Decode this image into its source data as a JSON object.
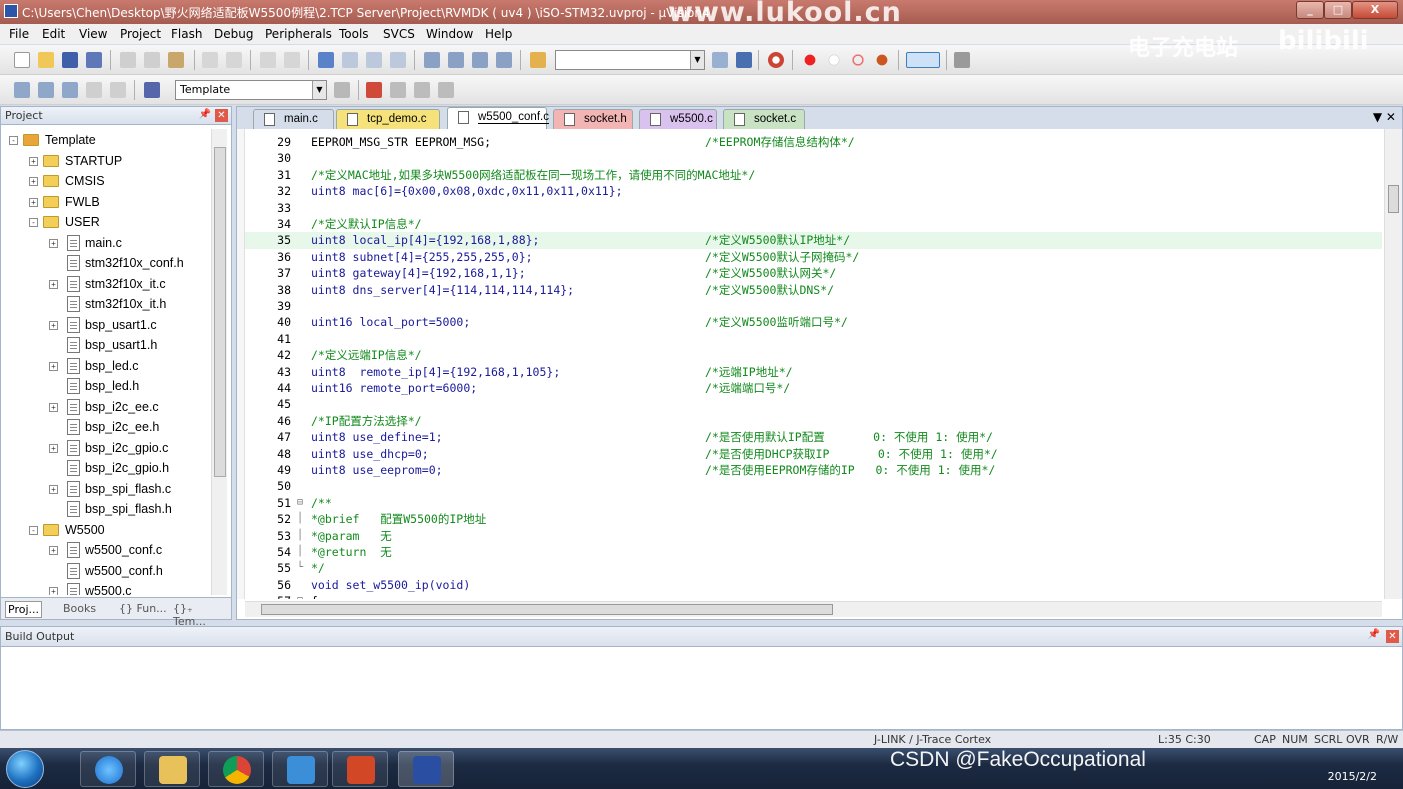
{
  "titlebar": {
    "title": "C:\\Users\\Chen\\Desktop\\野火网络适配板W5500例程\\2.TCP Server\\Project\\RVMDK ( uv4 ) \\iSO-STM32.uvproj - µVision4",
    "watermark": "www.lukool.cn",
    "minimize": "_",
    "maximize": "□",
    "close": "X"
  },
  "watermark_bilibili": "电子充电站",
  "watermark_bilibili_logo": "bilibili",
  "menu": [
    "File",
    "Edit",
    "View",
    "Project",
    "Flash",
    "Debug",
    "Peripherals",
    "Tools",
    "SVCS",
    "Window",
    "Help"
  ],
  "toolbar2": {
    "target_combo": "Template"
  },
  "project_panel": {
    "title": "Project",
    "tree": [
      {
        "label": "Template",
        "level": 0,
        "type": "project",
        "expand": "-"
      },
      {
        "label": "STARTUP",
        "level": 1,
        "type": "folder",
        "expand": "+"
      },
      {
        "label": "CMSIS",
        "level": 1,
        "type": "folder",
        "expand": "+"
      },
      {
        "label": "FWLB",
        "level": 1,
        "type": "folder",
        "expand": "+"
      },
      {
        "label": "USER",
        "level": 1,
        "type": "folder",
        "expand": "-"
      },
      {
        "label": "main.c",
        "level": 2,
        "type": "file",
        "expand": "+"
      },
      {
        "label": "stm32f10x_conf.h",
        "level": 2,
        "type": "file",
        "expand": ""
      },
      {
        "label": "stm32f10x_it.c",
        "level": 2,
        "type": "file",
        "expand": "+"
      },
      {
        "label": "stm32f10x_it.h",
        "level": 2,
        "type": "file",
        "expand": ""
      },
      {
        "label": "bsp_usart1.c",
        "level": 2,
        "type": "file",
        "expand": "+"
      },
      {
        "label": "bsp_usart1.h",
        "level": 2,
        "type": "file",
        "expand": ""
      },
      {
        "label": "bsp_led.c",
        "level": 2,
        "type": "file",
        "expand": "+"
      },
      {
        "label": "bsp_led.h",
        "level": 2,
        "type": "file",
        "expand": ""
      },
      {
        "label": "bsp_i2c_ee.c",
        "level": 2,
        "type": "file",
        "expand": "+"
      },
      {
        "label": "bsp_i2c_ee.h",
        "level": 2,
        "type": "file",
        "expand": ""
      },
      {
        "label": "bsp_i2c_gpio.c",
        "level": 2,
        "type": "file",
        "expand": "+"
      },
      {
        "label": "bsp_i2c_gpio.h",
        "level": 2,
        "type": "file",
        "expand": ""
      },
      {
        "label": "bsp_spi_flash.c",
        "level": 2,
        "type": "file",
        "expand": "+"
      },
      {
        "label": "bsp_spi_flash.h",
        "level": 2,
        "type": "file",
        "expand": ""
      },
      {
        "label": "W5500",
        "level": 1,
        "type": "folder",
        "expand": "-"
      },
      {
        "label": "w5500_conf.c",
        "level": 2,
        "type": "file",
        "expand": "+"
      },
      {
        "label": "w5500_conf.h",
        "level": 2,
        "type": "file",
        "expand": ""
      },
      {
        "label": "w5500.c",
        "level": 2,
        "type": "file",
        "expand": "+"
      }
    ],
    "tabs": [
      "Proj...",
      "Books",
      "{} Fun...",
      "{}₊ Tem..."
    ]
  },
  "editor": {
    "tabs": [
      {
        "label": "main.c",
        "color": "#d4dde9",
        "active": false
      },
      {
        "label": "tcp_demo.c",
        "color": "#f5e27a",
        "active": false
      },
      {
        "label": "w5500_conf.c",
        "color": "#ffffff",
        "active": true
      },
      {
        "label": "socket.h",
        "color": "#f3b4b4",
        "active": false
      },
      {
        "label": "w5500.c",
        "color": "#d9c2ee",
        "active": false
      },
      {
        "label": "socket.c",
        "color": "#c9e2c4",
        "active": false
      }
    ],
    "tab_controls": "▼  ✕",
    "lines": [
      {
        "n": "29",
        "code": "EEPROM_MSG_STR EEPROM_MSG;",
        "comment": "/*EEPROM存储信息结构体*/",
        "fold": ""
      },
      {
        "n": "30",
        "code": "",
        "comment": "",
        "fold": ""
      },
      {
        "n": "31",
        "code": "/*定义MAC地址,如果多块W5500网络适配板在同一现场工作，请使用不同的MAC地址*/",
        "comment": "",
        "fold": "",
        "is_comment": true
      },
      {
        "n": "32",
        "code": "uint8 mac[6]={0x00,0x08,0xdc,0x11,0x11,0x11};",
        "comment": "",
        "fold": ""
      },
      {
        "n": "33",
        "code": "",
        "comment": "",
        "fold": ""
      },
      {
        "n": "34",
        "code": "/*定义默认IP信息*/",
        "comment": "",
        "fold": "",
        "is_comment": true
      },
      {
        "n": "35",
        "code": "uint8 local_ip[4]={192,168,1,88};",
        "comment": "/*定义W5500默认IP地址*/",
        "fold": "",
        "highlight": true
      },
      {
        "n": "36",
        "code": "uint8 subnet[4]={255,255,255,0};",
        "comment": "/*定义W5500默认子网掩码*/",
        "fold": ""
      },
      {
        "n": "37",
        "code": "uint8 gateway[4]={192,168,1,1};",
        "comment": "/*定义W5500默认网关*/",
        "fold": ""
      },
      {
        "n": "38",
        "code": "uint8 dns_server[4]={114,114,114,114};",
        "comment": "/*定义W5500默认DNS*/",
        "fold": ""
      },
      {
        "n": "39",
        "code": "",
        "comment": "",
        "fold": ""
      },
      {
        "n": "40",
        "code": "uint16 local_port=5000;",
        "comment": "/*定义W5500监听端口号*/",
        "fold": ""
      },
      {
        "n": "41",
        "code": "",
        "comment": "",
        "fold": ""
      },
      {
        "n": "42",
        "code": "/*定义远端IP信息*/",
        "comment": "",
        "fold": "",
        "is_comment": true
      },
      {
        "n": "43",
        "code": "uint8  remote_ip[4]={192,168,1,105};",
        "comment": "/*远端IP地址*/",
        "fold": ""
      },
      {
        "n": "44",
        "code": "uint16 remote_port=6000;",
        "comment": "/*远端端口号*/",
        "fold": ""
      },
      {
        "n": "45",
        "code": "",
        "comment": "",
        "fold": ""
      },
      {
        "n": "46",
        "code": "/*IP配置方法选择*/",
        "comment": "",
        "fold": "",
        "is_comment": true
      },
      {
        "n": "47",
        "code": "uint8 use_define=1;",
        "comment": "/*是否使用默认IP配置       0: 不使用 1: 使用*/",
        "fold": ""
      },
      {
        "n": "48",
        "code": "uint8 use_dhcp=0;",
        "comment": "/*是否使用DHCP获取IP       0: 不使用 1: 使用*/",
        "fold": ""
      },
      {
        "n": "49",
        "code": "uint8 use_eeprom=0;",
        "comment": "/*是否使用EEPROM存储的IP   0: 不使用 1: 使用*/",
        "fold": ""
      },
      {
        "n": "50",
        "code": "",
        "comment": "",
        "fold": ""
      },
      {
        "n": "51",
        "code": "/**",
        "comment": "",
        "fold": "⊟",
        "is_comment": true
      },
      {
        "n": "52",
        "code": "*@brief   配置W5500的IP地址",
        "comment": "",
        "fold": "│",
        "is_comment": true
      },
      {
        "n": "53",
        "code": "*@param   无",
        "comment": "",
        "fold": "│",
        "is_comment": true
      },
      {
        "n": "54",
        "code": "*@return  无",
        "comment": "",
        "fold": "│",
        "is_comment": true
      },
      {
        "n": "55",
        "code": "*/",
        "comment": "",
        "fold": "└",
        "is_comment": true
      },
      {
        "n": "56",
        "code": "void set_w5500_ip(void)",
        "comment": "",
        "fold": ""
      },
      {
        "n": "57",
        "code": "{",
        "comment": "",
        "fold": "⊟"
      }
    ]
  },
  "build_output": {
    "title": "Build Output"
  },
  "status": {
    "debugger": "J-LINK / J-Trace Cortex",
    "position": "L:35 C:30",
    "indicators": [
      "CAP",
      "NUM",
      "SCRL",
      "OVR",
      "R/W"
    ]
  },
  "taskbar": {
    "csdn_watermark": "CSDN @FakeOccupational",
    "date": "2015/2/2"
  }
}
